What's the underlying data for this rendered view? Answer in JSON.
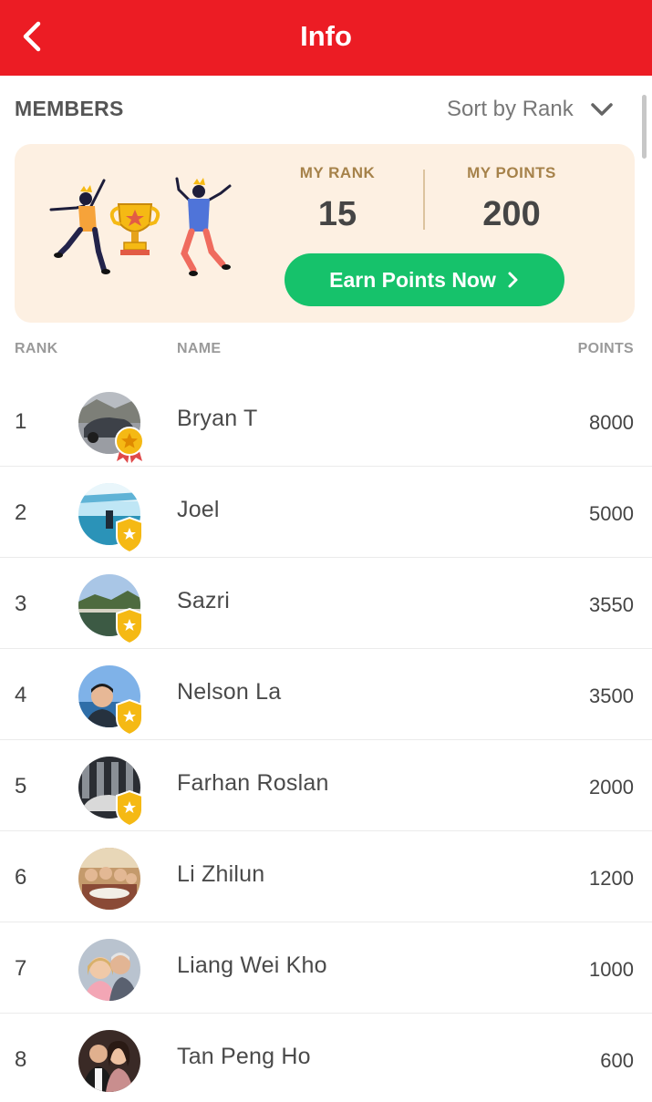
{
  "header": {
    "title": "Info",
    "back_icon": "chevron-left-icon"
  },
  "members": {
    "label": "MEMBERS",
    "sort_label": "Sort by Rank",
    "sort_icon": "chevron-down-icon"
  },
  "rank_card": {
    "illustration": "celebrating-people-with-trophy",
    "rank_label": "MY RANK",
    "rank_value": "15",
    "points_label": "MY POINTS",
    "points_value": "200",
    "cta_label": "Earn Points Now",
    "cta_icon": "chevron-right-icon"
  },
  "columns": {
    "rank": "RANK",
    "name": "NAME",
    "points": "POINTS"
  },
  "members_list": [
    {
      "rank": "1",
      "name": "Bryan T",
      "points": "8000",
      "badge": "gold-medal-icon"
    },
    {
      "rank": "2",
      "name": "Joel",
      "points": "5000",
      "badge": "shield-badge-icon"
    },
    {
      "rank": "3",
      "name": "Sazri",
      "points": "3550",
      "badge": "shield-badge-icon"
    },
    {
      "rank": "4",
      "name": "Nelson La",
      "points": "3500",
      "badge": "shield-badge-icon"
    },
    {
      "rank": "5",
      "name": "Farhan Roslan",
      "points": "2000",
      "badge": "shield-badge-icon"
    },
    {
      "rank": "6",
      "name": "Li Zhilun",
      "points": "1200",
      "badge": ""
    },
    {
      "rank": "7",
      "name": "Liang Wei Kho",
      "points": "1000",
      "badge": ""
    },
    {
      "rank": "8",
      "name": "Tan Peng Ho",
      "points": "600",
      "badge": ""
    }
  ],
  "colors": {
    "header_red": "#ec1c24",
    "card_bg": "#fdf0e2",
    "card_label_gold": "#a6824a",
    "cta_green": "#16c26b",
    "badge_gold": "#f5b914"
  }
}
